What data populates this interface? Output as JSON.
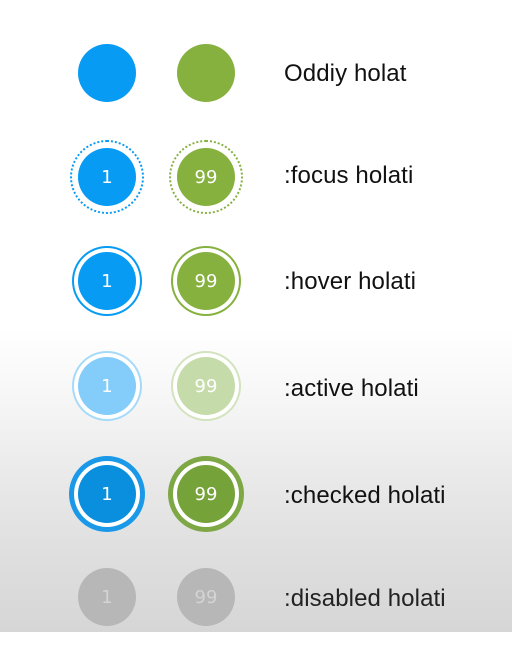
{
  "rows": [
    {
      "label": "Oddiy holat",
      "blue_value": "",
      "green_value": ""
    },
    {
      "label": ":focus holati",
      "blue_value": "1",
      "green_value": "99"
    },
    {
      "label": ":hover holati",
      "blue_value": "1",
      "green_value": "99"
    },
    {
      "label": ":active holati",
      "blue_value": "1",
      "green_value": "99"
    },
    {
      "label": ":checked holati",
      "blue_value": "1",
      "green_value": "99"
    },
    {
      "label": ":disabled holati",
      "blue_value": "1",
      "green_value": "99"
    }
  ],
  "colors": {
    "blue": "#089bf3",
    "green": "#86b13f",
    "disabled": "#b7b7b7"
  }
}
